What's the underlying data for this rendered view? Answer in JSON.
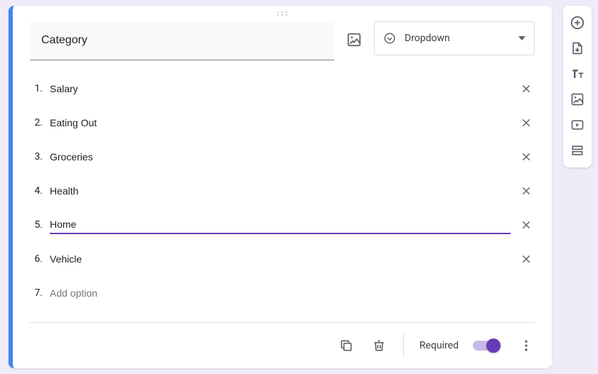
{
  "question": {
    "title": "Category",
    "type_label": "Dropdown",
    "options": [
      {
        "num": "1.",
        "label": "Salary",
        "active": false,
        "placeholder": false,
        "removable": true
      },
      {
        "num": "2.",
        "label": "Eating Out",
        "active": false,
        "placeholder": false,
        "removable": true
      },
      {
        "num": "3.",
        "label": "Groceries",
        "active": false,
        "placeholder": false,
        "removable": true
      },
      {
        "num": "4.",
        "label": "Health",
        "active": false,
        "placeholder": false,
        "removable": true
      },
      {
        "num": "5.",
        "label": "Home",
        "active": true,
        "placeholder": false,
        "removable": true
      },
      {
        "num": "6.",
        "label": "Vehicle",
        "active": false,
        "placeholder": false,
        "removable": true
      },
      {
        "num": "7.",
        "label": "Add option",
        "active": false,
        "placeholder": true,
        "removable": false
      }
    ]
  },
  "footer": {
    "required_label": "Required",
    "required_on": true
  }
}
